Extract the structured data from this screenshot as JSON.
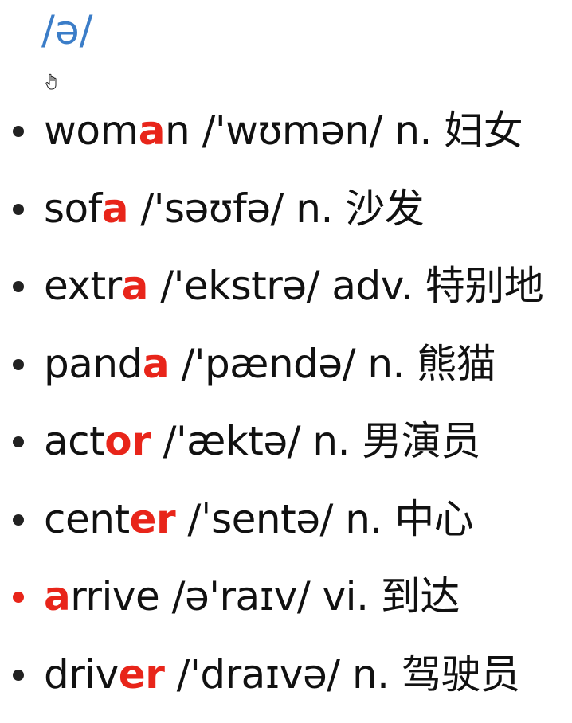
{
  "title": "/ə/",
  "accent_color": "#e8251a",
  "title_color": "#3b7dc8",
  "cursor_icon": "hand-pointer-icon",
  "items": [
    {
      "pre": "wom",
      "hl": "a",
      "post": "n",
      "phonetic": " /'wʊmən/",
      "pos": " n.",
      "meaning": " 妇女",
      "bullet_color": "#222222"
    },
    {
      "pre": "sof",
      "hl": "a",
      "post": "",
      "phonetic": " /'səʊfə/",
      "pos": " n.",
      "meaning": " 沙发",
      "bullet_color": "#222222"
    },
    {
      "pre": "extr",
      "hl": "a",
      "post": "",
      "phonetic": " /'ekstrə/",
      "pos": " adv.",
      "meaning": " 特别地",
      "bullet_color": "#222222"
    },
    {
      "pre": "pand",
      "hl": "a",
      "post": "",
      "phonetic": " /'pændə/",
      "pos": " n.",
      "meaning": " 熊猫",
      "bullet_color": "#222222"
    },
    {
      "pre": "act",
      "hl": "or",
      "post": "",
      "phonetic": " /'æktə/",
      "pos": " n.",
      "meaning": " 男演员",
      "bullet_color": "#222222"
    },
    {
      "pre": "cent",
      "hl": "er",
      "post": "",
      "phonetic": " /ˈsentə/",
      "pos": " n.",
      "meaning": " 中心",
      "bullet_color": "#222222"
    },
    {
      "pre": "",
      "hl": "a",
      "post": "rrive",
      "phonetic": " /ə'raɪv/",
      "pos": " vi.",
      "meaning": " 到达",
      "bullet_color": "#e8251a"
    },
    {
      "pre": "driv",
      "hl": "er",
      "post": "",
      "phonetic": " /'draɪvə/",
      "pos": " n.",
      "meaning": " 驾驶员",
      "bullet_color": "#222222"
    }
  ]
}
